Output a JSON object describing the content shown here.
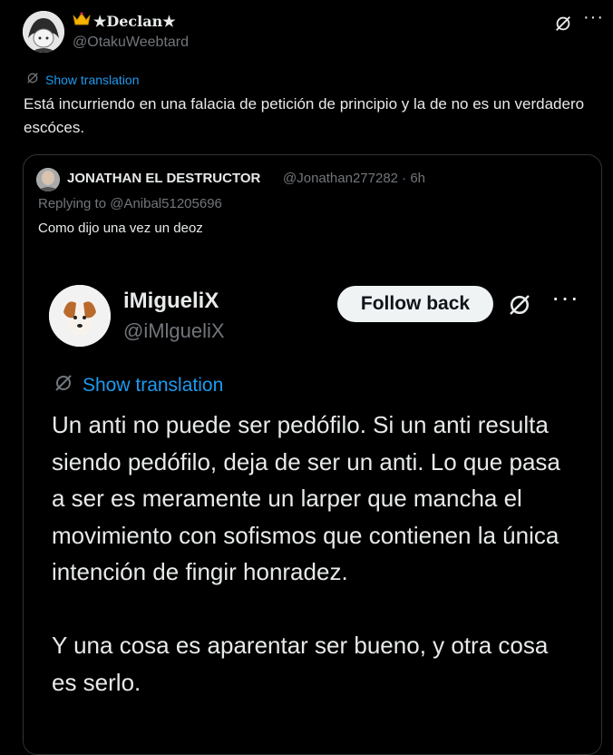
{
  "header": {
    "display_name": "★Declan★",
    "handle": "@OtakuWeebtard",
    "icons": {
      "crown": "crown-icon",
      "mute": "mute-icon",
      "more": "more-icon"
    },
    "more_glyph": "···"
  },
  "tweet": {
    "show_translation": "Show translation",
    "text": "Está incurriendo en una falacia de petición de principio y la de no es un verdadero escóces."
  },
  "quote": {
    "author_name": "JONATHAN EL DESTRUCTOR",
    "meta": "@Jonathan277282 · 6h",
    "replying_to": "Replying to @Anibal51205696",
    "text": "Como dijo una vez un deoz",
    "screenshot": {
      "name": "iMigueliX",
      "handle": "@iMlgueliX",
      "follow_label": "Follow back",
      "more_glyph": "···",
      "show_translation": "Show translation",
      "text": "Un anti no puede ser pedófilo. Si un anti resulta siendo pedófilo, deja de ser un anti. Lo que pasa a ser es meramente un larper que mancha el movimiento con sofismos que contienen la única intención de fingir honradez.\n\nY una cosa es aparentar ser bueno, y otra cosa es serlo."
    }
  },
  "colors": {
    "background": "#000000",
    "text": "#e7e9ea",
    "muted": "#71767b",
    "link": "#1d9bf0",
    "border": "#2f3336",
    "button_bg": "#eff3f4"
  }
}
